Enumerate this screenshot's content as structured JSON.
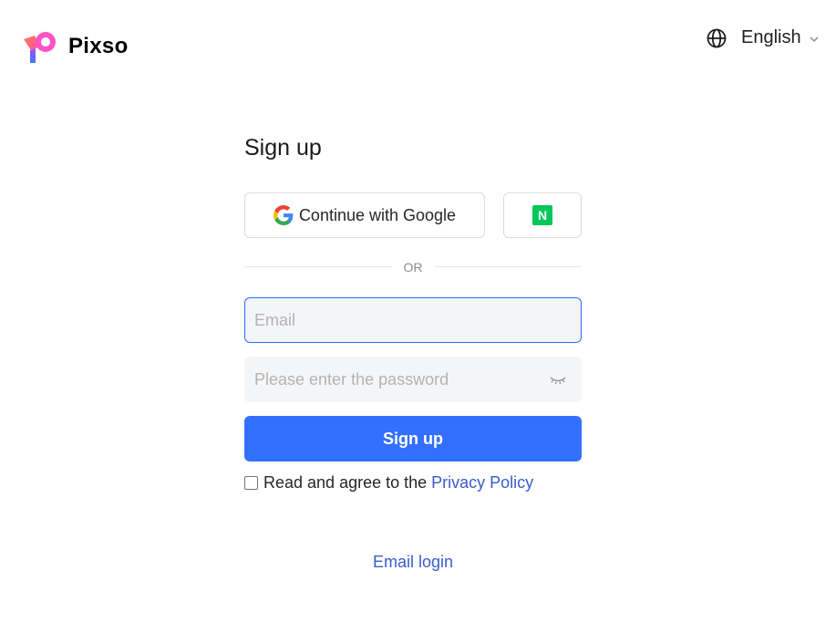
{
  "brand": {
    "name": "Pixso"
  },
  "language": {
    "label": "English",
    "icon": "globe-icon"
  },
  "form": {
    "title": "Sign up",
    "google_button": "Continue with Google",
    "naver_button": "N",
    "divider": "OR",
    "email_placeholder": "Email",
    "email_value": "",
    "password_placeholder": "Please enter the password",
    "password_value": "",
    "signup_button": "Sign up",
    "agree_text": "Read and agree to the",
    "privacy_link": "Privacy Policy",
    "agree_checked": false,
    "email_login": "Email login"
  },
  "colors": {
    "primary": "#3370ff",
    "link": "#3a5ccc",
    "naver": "#03c75a",
    "input_bg": "#f4f5f7",
    "focus_border": "#2f6bff"
  }
}
